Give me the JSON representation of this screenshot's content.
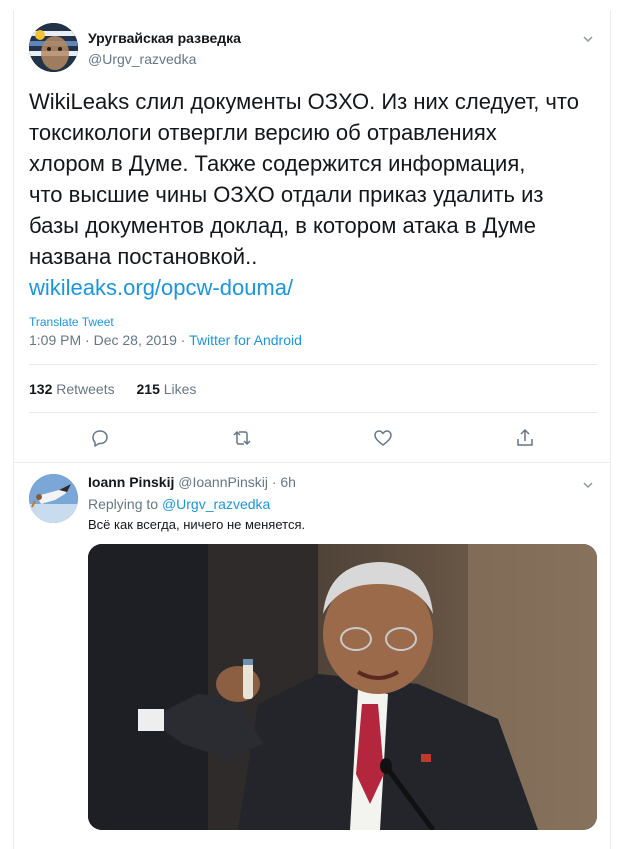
{
  "main_tweet": {
    "display_name": "Уругвайская разведка",
    "handle": "@Urgv_razvedka",
    "text_lines": [
      "WikiLeaks слил документы ОЗХО. Из них следует, что",
      "токсикологи отвергли версию об отравлениях",
      "хлором в Думе. Также содержится информация,",
      "что высшие чины ОЗХО отдали приказ удалить из",
      "базы документов доклад, в котором атака в Думе",
      "названа постановкой.."
    ],
    "link": "wikileaks.org/opcw-douma/",
    "translate_label": "Translate Tweet",
    "timestamp": "1:09 PM · Dec 28, 2019 · ",
    "source": "Twitter for Android",
    "retweets_count": "132",
    "retweets_label": "Retweets",
    "likes_count": "215",
    "likes_label": "Likes",
    "actions": [
      "reply-icon",
      "retweet-icon",
      "like-icon",
      "share-icon"
    ]
  },
  "reply": {
    "display_name": "Ioann Pinskij",
    "handle_time": "@IoannPinskij · 6h",
    "replying_label": "Replying to ",
    "replying_to": "@Urgv_razvedka",
    "text": "Всё как всегда, ничего не меняется."
  },
  "colors": {
    "link": "#1b95e0",
    "secondary_text": "#657786",
    "primary_text": "#14171a",
    "divider": "#e6ecf0"
  }
}
